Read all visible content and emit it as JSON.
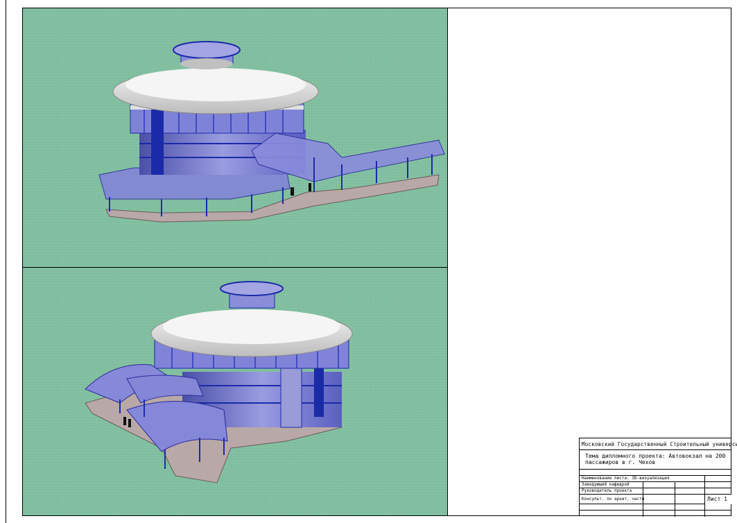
{
  "stamp": {
    "university": "Московский Государственный Строительный университет",
    "topic": "Тема дипломного проекта: Автовокзал на 200 пассажиров в г. Чехов",
    "sheet_name": "Наименование листа: 3D-визуализация",
    "head_of_department": "Заведующий кафедрой",
    "project_lead": "Руководитель проекта",
    "arch_consultant": "Консульт. по архит. части",
    "sheet_number": "Лист 1"
  },
  "colors": {
    "background_view": "#82bfa0",
    "glass": "#7d7fd6",
    "blue_frame": "#1a2aa8",
    "roof": "#e8e8e8"
  }
}
